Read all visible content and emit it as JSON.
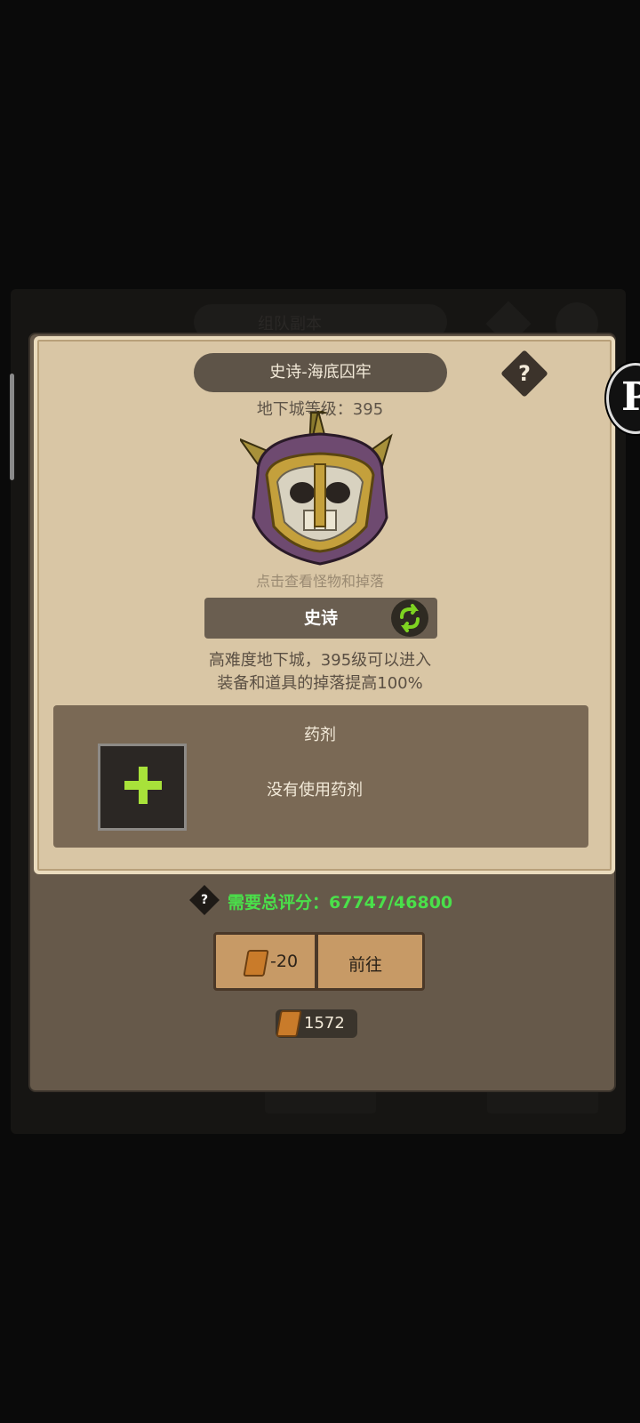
{
  "background": {
    "pill_text": "组队副本"
  },
  "dialog": {
    "title": "史诗-海底囚牢",
    "help_icon": "question-icon",
    "level_label": "地下城等级：395",
    "monster_icon": "skull-helmet-icon",
    "hint": "点击查看怪物和掉落",
    "difficulty": "史诗",
    "swap_icon": "swap-icon",
    "description_line1": "高难度地下城，395级可以进入",
    "description_line2": "装备和道具的掉落提高100%",
    "potion_title": "药剂",
    "potion_slot_icon": "plus-icon",
    "potion_status": "没有使用药剂"
  },
  "requirement": {
    "text": "需要总评分：67747/46800",
    "color": "#4ae04a"
  },
  "action": {
    "cost": "-20",
    "go_label": "前往",
    "ticket_icon": "ticket-icon"
  },
  "balance": {
    "value": "1572"
  }
}
